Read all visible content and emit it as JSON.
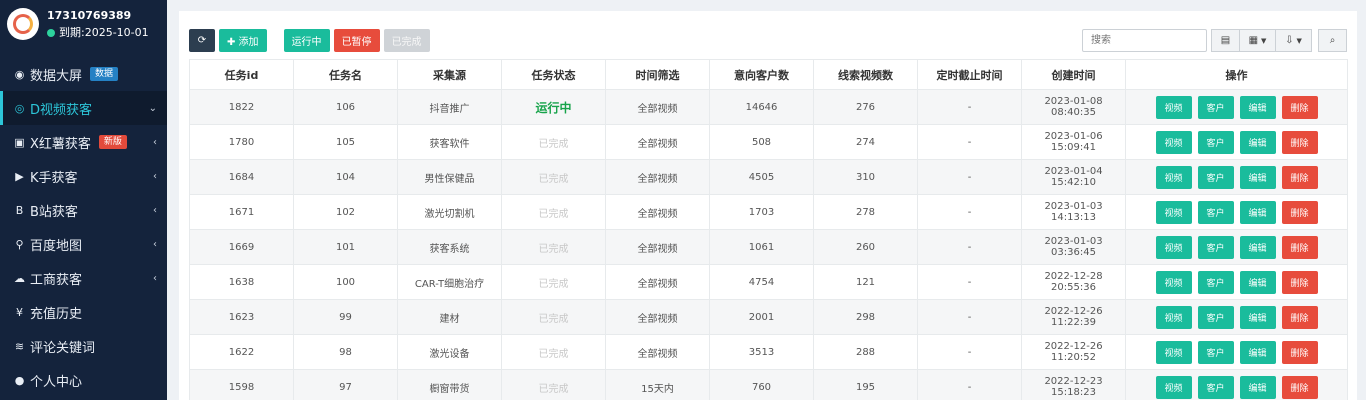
{
  "profile": {
    "phone": "17310769389",
    "expiry": "到期:2025-10-01"
  },
  "nav": [
    {
      "icon": "dashboard-icon",
      "glyph": "◉",
      "label": "数据大屏",
      "badge": "数据",
      "badge_color": "blue",
      "chevron": "",
      "active": false
    },
    {
      "icon": "eye-icon",
      "glyph": "◎",
      "label": "D视频获客",
      "badge": "",
      "badge_color": "",
      "chevron": "⌄",
      "active": true
    },
    {
      "icon": "book-icon",
      "glyph": "▣",
      "label": "X红薯获客",
      "badge": "新版",
      "badge_color": "red",
      "chevron": "‹",
      "active": false
    },
    {
      "icon": "play-circle-icon",
      "glyph": "▶",
      "label": "K手获客",
      "badge": "",
      "badge_color": "",
      "chevron": "‹",
      "active": false
    },
    {
      "icon": "bold-b-icon",
      "glyph": "B",
      "label": "B站获客",
      "badge": "",
      "badge_color": "",
      "chevron": "‹",
      "active": false
    },
    {
      "icon": "map-pin-icon",
      "glyph": "⚲",
      "label": "百度地图",
      "badge": "",
      "badge_color": "",
      "chevron": "‹",
      "active": false
    },
    {
      "icon": "cloud-icon",
      "glyph": "☁",
      "label": "工商获客",
      "badge": "",
      "badge_color": "",
      "chevron": "‹",
      "active": false
    },
    {
      "icon": "yen-icon",
      "glyph": "¥",
      "label": "充值历史",
      "badge": "",
      "badge_color": "",
      "chevron": "",
      "active": false
    },
    {
      "icon": "rss-icon",
      "glyph": "≋",
      "label": "评论关键词",
      "badge": "",
      "badge_color": "",
      "chevron": "",
      "active": false
    },
    {
      "icon": "user-icon",
      "glyph": "●",
      "label": "个人中心",
      "badge": "",
      "badge_color": "",
      "chevron": "",
      "active": false
    }
  ],
  "toolbar": {
    "refresh_icon": "refresh-icon",
    "add_label": "✚ 添加",
    "running_label": "运行中",
    "paused_label": "已暂停",
    "done_label": "已完成"
  },
  "search": {
    "placeholder": "搜索"
  },
  "tools": {
    "view_icon": "grid-view-icon",
    "columns_icon": "columns-icon",
    "export_icon": "export-icon",
    "search_icon": "search-icon"
  },
  "table": {
    "headers": [
      "任务id",
      "任务名",
      "采集源",
      "任务状态",
      "时间筛选",
      "意向客户数",
      "线索视频数",
      "定时截止时间",
      "创建时间",
      "操作"
    ],
    "op_labels": {
      "video": "视频",
      "customer": "客户",
      "edit": "编辑",
      "delete": "删除"
    },
    "rows": [
      {
        "id": "1822",
        "name": "106",
        "source": "抖音推广",
        "status": "运行中",
        "running": true,
        "filter": "全部视频",
        "customers": "14646",
        "videos": "276",
        "deadline": "-",
        "created": "2023-01-08 08:40:35"
      },
      {
        "id": "1780",
        "name": "105",
        "source": "获客软件",
        "status": "已完成",
        "running": false,
        "filter": "全部视频",
        "customers": "508",
        "videos": "274",
        "deadline": "-",
        "created": "2023-01-06 15:09:41"
      },
      {
        "id": "1684",
        "name": "104",
        "source": "男性保健品",
        "status": "已完成",
        "running": false,
        "filter": "全部视频",
        "customers": "4505",
        "videos": "310",
        "deadline": "-",
        "created": "2023-01-04 15:42:10"
      },
      {
        "id": "1671",
        "name": "102",
        "source": "激光切割机",
        "status": "已完成",
        "running": false,
        "filter": "全部视频",
        "customers": "1703",
        "videos": "278",
        "deadline": "-",
        "created": "2023-01-03 14:13:13"
      },
      {
        "id": "1669",
        "name": "101",
        "source": "获客系统",
        "status": "已完成",
        "running": false,
        "filter": "全部视频",
        "customers": "1061",
        "videos": "260",
        "deadline": "-",
        "created": "2023-01-03 03:36:45"
      },
      {
        "id": "1638",
        "name": "100",
        "source": "CAR-T细胞治疗",
        "status": "已完成",
        "running": false,
        "filter": "全部视频",
        "customers": "4754",
        "videos": "121",
        "deadline": "-",
        "created": "2022-12-28 20:55:36"
      },
      {
        "id": "1623",
        "name": "99",
        "source": "建材",
        "status": "已完成",
        "running": false,
        "filter": "全部视频",
        "customers": "2001",
        "videos": "298",
        "deadline": "-",
        "created": "2022-12-26 11:22:39"
      },
      {
        "id": "1622",
        "name": "98",
        "source": "激光设备",
        "status": "已完成",
        "running": false,
        "filter": "全部视频",
        "customers": "3513",
        "videos": "288",
        "deadline": "-",
        "created": "2022-12-26 11:20:52"
      },
      {
        "id": "1598",
        "name": "97",
        "source": "橱窗带货",
        "status": "已完成",
        "running": false,
        "filter": "15天内",
        "customers": "760",
        "videos": "195",
        "deadline": "-",
        "created": "2022-12-23 15:18:23"
      }
    ]
  }
}
